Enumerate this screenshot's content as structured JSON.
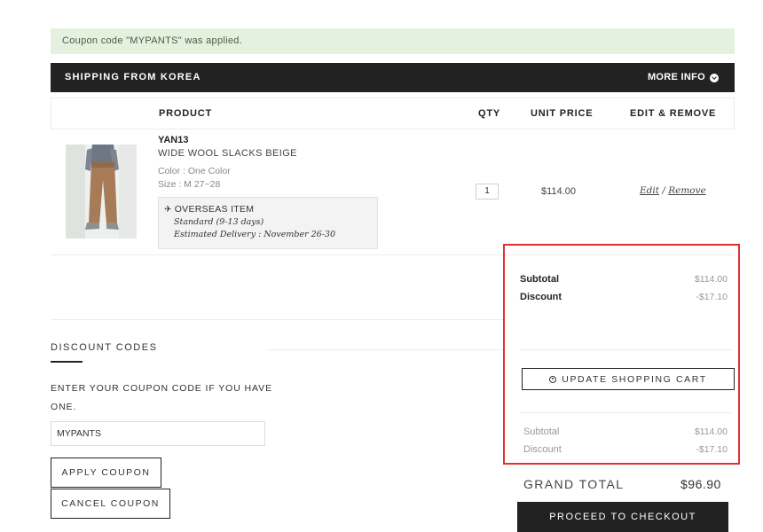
{
  "notice": {
    "text": "Coupon code \"MYPANTS\" was applied."
  },
  "shipping_bar": {
    "title": "SHIPPING FROM KOREA",
    "more_info": "MORE INFO"
  },
  "table": {
    "headers": {
      "product": "PRODUCT",
      "qty": "QTY",
      "unit_price": "UNIT PRICE",
      "edit_remove": "EDIT & REMOVE"
    }
  },
  "item": {
    "code": "YAN13",
    "name": "WIDE WOOL SLACKS BEIGE",
    "color": "Color : One Color",
    "size": "Size : M 27~28",
    "overseas": {
      "title": "OVERSEAS ITEM",
      "shipping": "Standard (9-13 days)",
      "delivery": "Estimated Delivery : November 26-30"
    },
    "qty": "1",
    "unit_price": "$114.00",
    "edit": "Edit",
    "separator": "/",
    "remove": "Remove"
  },
  "summary": {
    "subtotal_label": "Subtotal",
    "subtotal_value": "$114.00",
    "discount_label": "Discount",
    "discount_value": "-$17.10",
    "update_button": "UPDATE SHOPPING CART",
    "subtotal2_label": "Subtotal",
    "subtotal2_value": "$114.00",
    "discount2_label": "Discount",
    "discount2_value": "-$17.10",
    "grand_total_label": "GRAND TOTAL",
    "grand_total_value": "$96.90",
    "checkout_button": "PROCEED TO CHECKOUT"
  },
  "discount": {
    "title": "DISCOUNT CODES",
    "label": "ENTER YOUR COUPON CODE IF YOU HAVE ONE.",
    "code_value": "MYPANTS",
    "apply_button": "APPLY COUPON",
    "cancel_button": "CANCEL COUPON"
  },
  "icons": {
    "more_info": "chevron-down-circle-icon",
    "plane": "airplane-icon",
    "update": "refresh-icon"
  },
  "colors": {
    "dark_bar": "#222222",
    "notice_bg": "#e5f1df",
    "highlight_border": "#e0312f"
  }
}
